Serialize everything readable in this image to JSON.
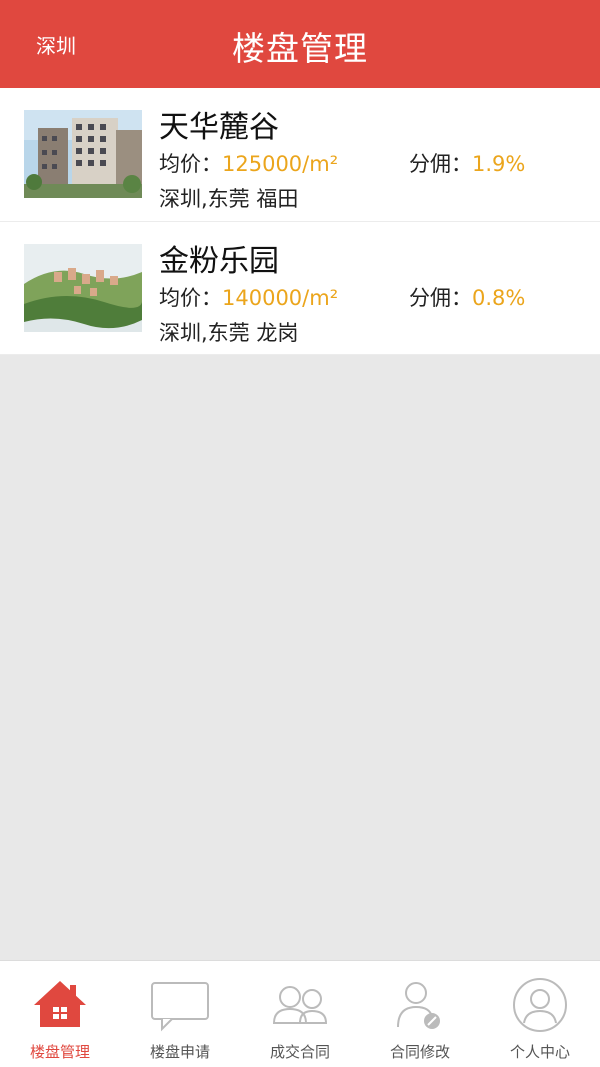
{
  "header": {
    "city": "深圳",
    "title": "楼盘管理"
  },
  "listings": [
    {
      "name": "天华麓谷",
      "price_label": "均价：",
      "price_value": "125000/m²",
      "commission_label": "分佣：",
      "commission_value": "1.9%",
      "location": "深圳,东莞 福田"
    },
    {
      "name": "金粉乐园",
      "price_label": "均价：",
      "price_value": "140000/m²",
      "commission_label": "分佣：",
      "commission_value": "0.8%",
      "location": "深圳,东莞 龙岗"
    }
  ],
  "tabbar": {
    "active_color": "#e0483f",
    "items": [
      {
        "label": "楼盘管理",
        "icon": "home-icon"
      },
      {
        "label": "楼盘申请",
        "icon": "message-icon"
      },
      {
        "label": "成交合同",
        "icon": "users-icon"
      },
      {
        "label": "合同修改",
        "icon": "edit-user-icon"
      },
      {
        "label": "个人中心",
        "icon": "profile-icon"
      }
    ]
  }
}
